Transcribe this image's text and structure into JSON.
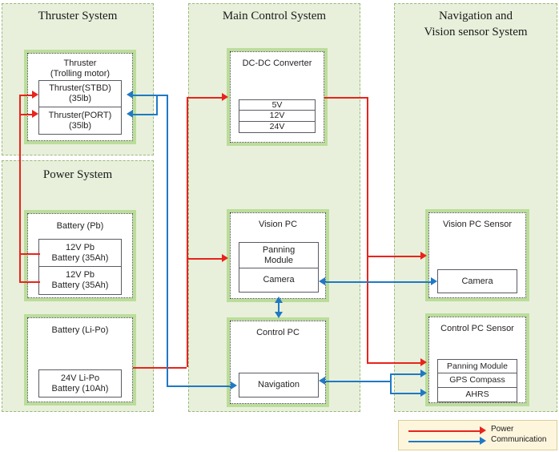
{
  "panels": [
    {
      "id": "thruster",
      "title": "Thruster System"
    },
    {
      "id": "power",
      "title": "Power System"
    },
    {
      "id": "main",
      "title": "Main Control System"
    },
    {
      "id": "navvision",
      "title": "Navigation  and\nVision sensor System"
    }
  ],
  "groups": {
    "thruster_group": {
      "title_line1": "Thruster",
      "title_line2": "(Trolling motor)",
      "items": [
        {
          "line1": "Thruster(STBD)",
          "line2": "(35lb)"
        },
        {
          "line1": "Thruster(PORT)",
          "line2": "(35lb)"
        }
      ]
    },
    "battery_pb": {
      "title": "Battery (Pb)",
      "items": [
        {
          "line1": "12V Pb",
          "line2": "Battery (35Ah)"
        },
        {
          "line1": "12V Pb",
          "line2": "Battery (35Ah)"
        }
      ]
    },
    "battery_lipo": {
      "title": "Battery (Li-Po)",
      "items": [
        {
          "line1": "24V Li-Po",
          "line2": "Battery (10Ah)"
        }
      ]
    },
    "dcdc": {
      "title": "DC-DC Converter",
      "items": [
        {
          "label": "5V"
        },
        {
          "label": "12V"
        },
        {
          "label": "24V"
        }
      ]
    },
    "vision_pc": {
      "title": "Vision PC",
      "items": [
        {
          "line1": "Panning",
          "line2": "Module"
        },
        {
          "line1": "Camera",
          "line2": ""
        }
      ]
    },
    "control_pc": {
      "title": "Control PC",
      "items": [
        {
          "label": "Navigation"
        }
      ]
    },
    "vision_pc_sensor": {
      "title": "Vision PC Sensor",
      "items": [
        {
          "label": "Camera"
        }
      ]
    },
    "control_pc_sensor": {
      "title": "Control PC Sensor",
      "items": [
        {
          "label": "Panning Module"
        },
        {
          "label": "GPS Compass"
        },
        {
          "label": "AHRS"
        }
      ]
    }
  },
  "legend": {
    "power_label": "Power",
    "comm_label": "Communication",
    "power_color": "#e8241c",
    "comm_color": "#1f79c4"
  },
  "colors": {
    "panel_fill": "#e8f0db",
    "panel_border": "#9ab87a",
    "group_glow": "#96cd64",
    "item_border": "#5a5a64",
    "legend_fill": "#fdf6dd"
  }
}
